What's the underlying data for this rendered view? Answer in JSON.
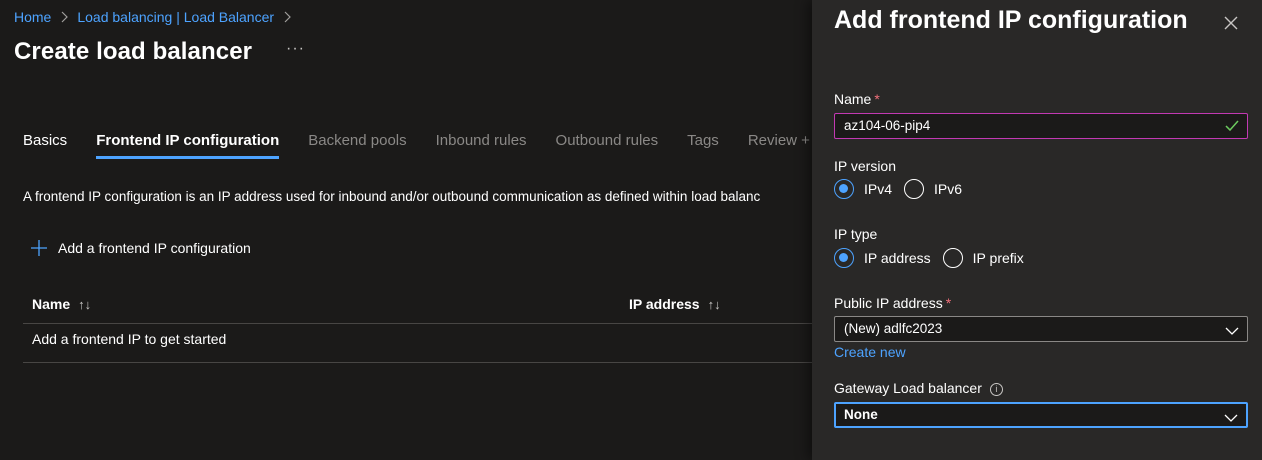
{
  "breadcrumb": {
    "home": "Home",
    "parent": "Load balancing | Load Balancer"
  },
  "page": {
    "title": "Create load balancer",
    "more": "···"
  },
  "tabs": [
    {
      "label": "Basics",
      "state": "done"
    },
    {
      "label": "Frontend IP configuration",
      "state": "active"
    },
    {
      "label": "Backend pools",
      "state": "disabled"
    },
    {
      "label": "Inbound rules",
      "state": "disabled"
    },
    {
      "label": "Outbound rules",
      "state": "disabled"
    },
    {
      "label": "Tags",
      "state": "disabled"
    },
    {
      "label": "Review + c",
      "state": "disabled"
    }
  ],
  "description": "A frontend IP configuration is an IP address used for inbound and/or outbound communication as defined within load balanc",
  "add_button": "Add a frontend IP configuration",
  "table": {
    "columns": [
      "Name",
      "IP address"
    ],
    "sort_icon": "↑↓",
    "empty": "Add a frontend IP to get started"
  },
  "panel": {
    "title": "Add frontend IP configuration",
    "name_label": "Name",
    "required_mark": "*",
    "name_value": "az104-06-pip4",
    "ip_version_label": "IP version",
    "ip_version_options": [
      "IPv4",
      "IPv6"
    ],
    "ip_version_selected": "IPv4",
    "ip_type_label": "IP type",
    "ip_type_options": [
      "IP address",
      "IP prefix"
    ],
    "ip_type_selected": "IP address",
    "public_ip_label": "Public IP address",
    "public_ip_value": "(New) adlfc2023",
    "create_new": "Create new",
    "gateway_label": "Gateway Load balancer",
    "gateway_info": "i",
    "gateway_value": "None"
  },
  "colors": {
    "accent": "#4da3ff",
    "focus_border": "#c239b3",
    "required": "#f1707b",
    "valid_check": "#6ccb5f"
  },
  "icons": [
    "chevron-right-icon",
    "more-icon",
    "plus-icon",
    "sort-icon",
    "close-icon",
    "check-icon",
    "chevron-down-icon",
    "info-icon"
  ]
}
